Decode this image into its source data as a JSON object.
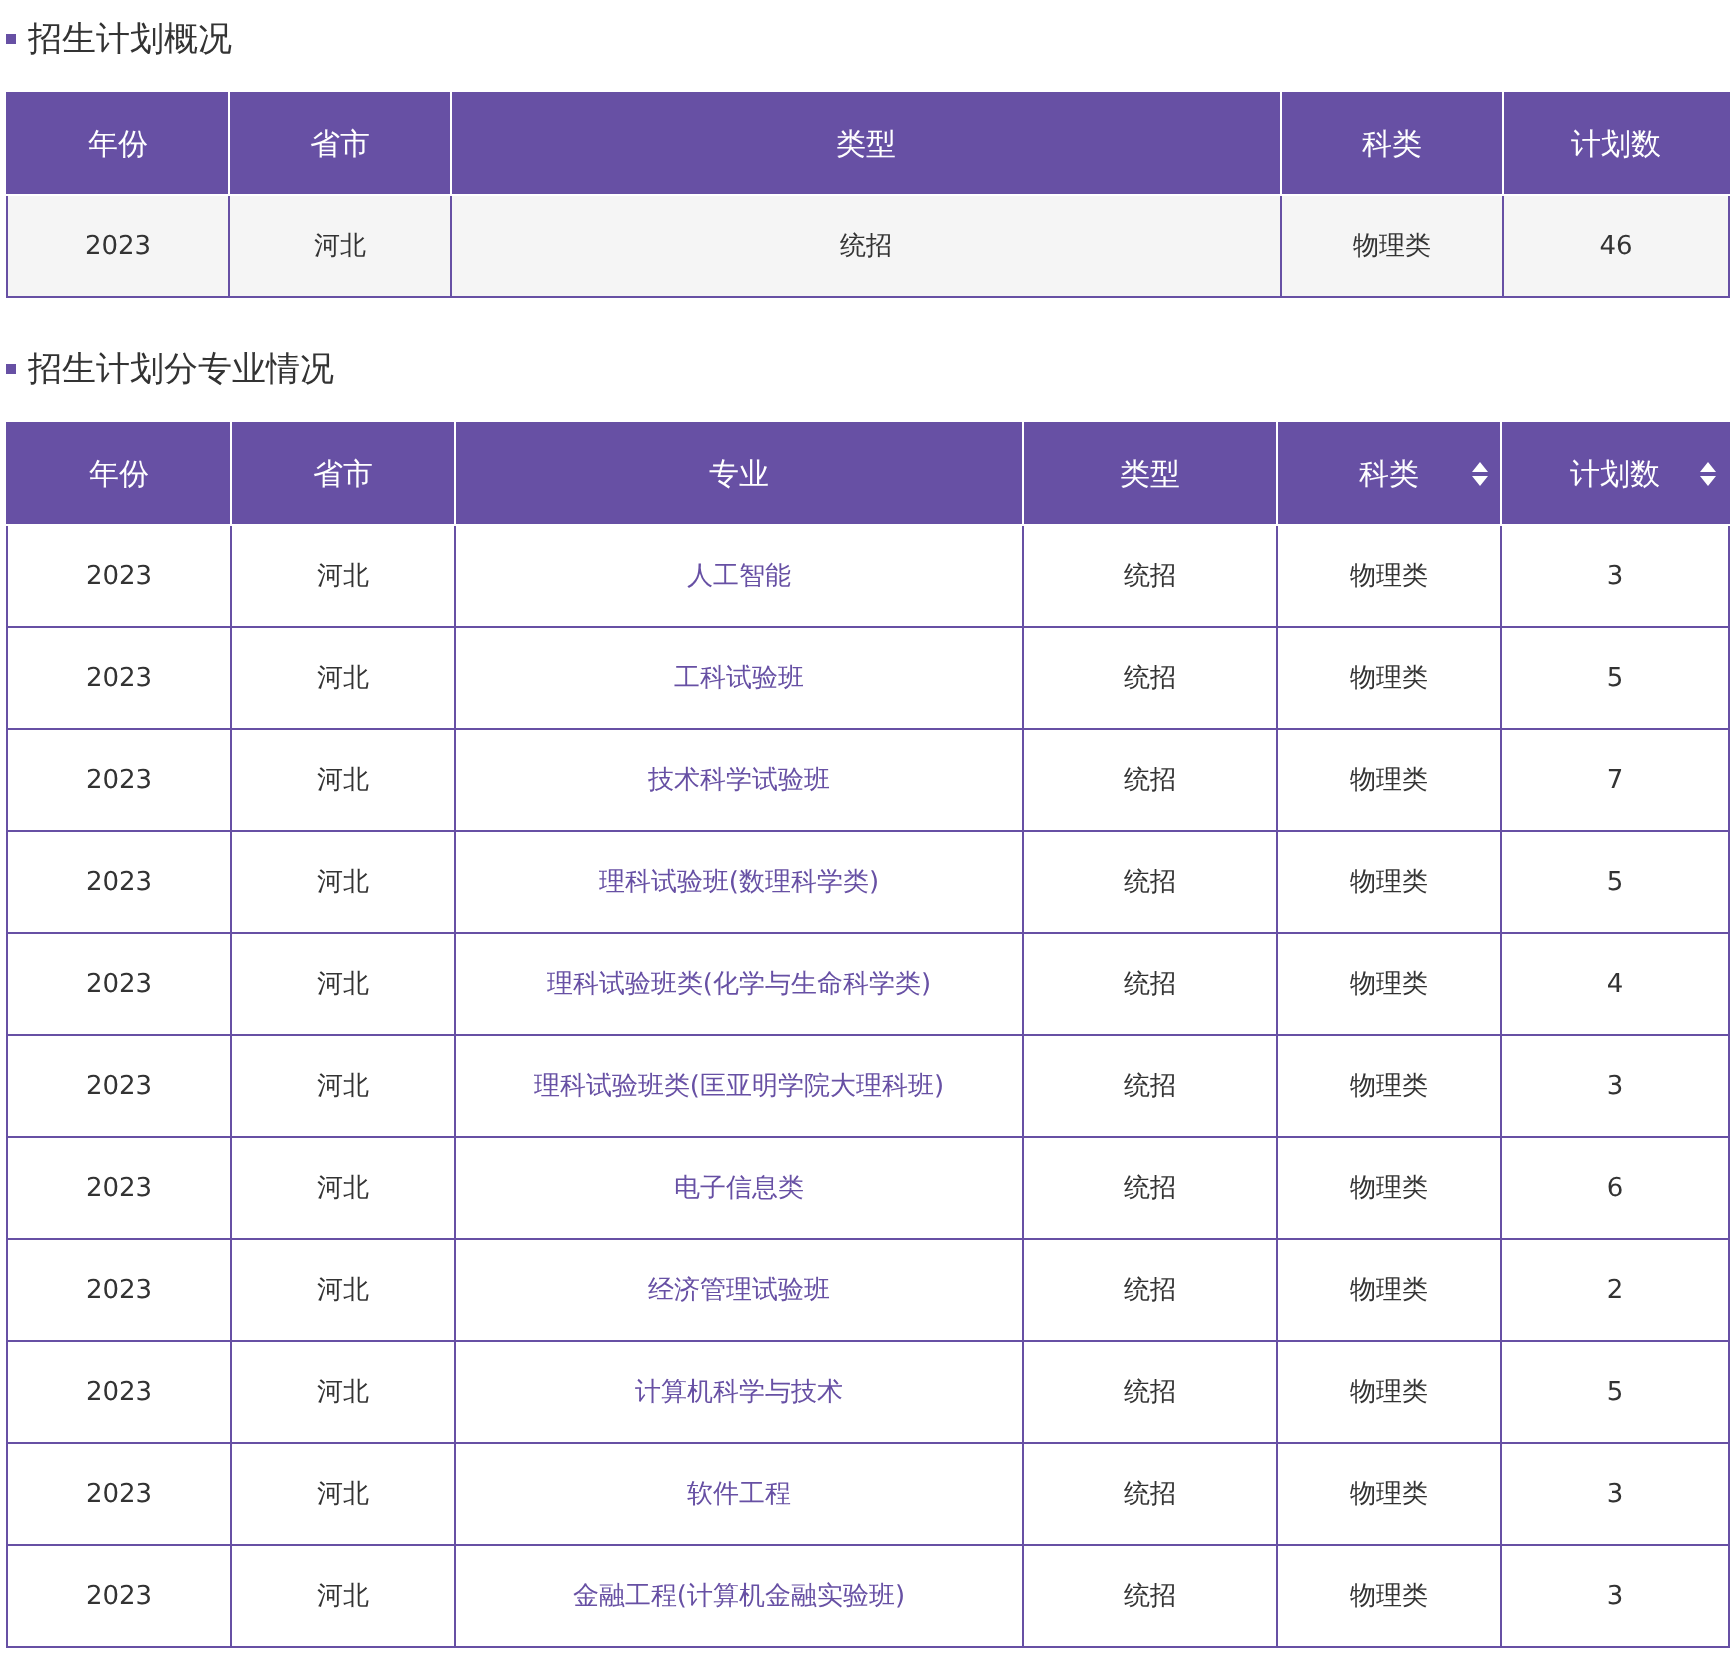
{
  "summary": {
    "title": "招生计划概况",
    "columns": [
      {
        "label": "年份",
        "sortable": false
      },
      {
        "label": "省市",
        "sortable": false
      },
      {
        "label": "类型",
        "sortable": false
      },
      {
        "label": "科类",
        "sortable": false
      },
      {
        "label": "计划数",
        "sortable": false
      }
    ],
    "rows": [
      [
        "2023",
        "河北",
        "统招",
        "物理类",
        "46"
      ]
    ]
  },
  "majors": {
    "title": "招生计划分专业情况",
    "columns": [
      {
        "label": "年份",
        "sortable": false
      },
      {
        "label": "省市",
        "sortable": false
      },
      {
        "label": "专业",
        "sortable": false
      },
      {
        "label": "类型",
        "sortable": false
      },
      {
        "label": "科类",
        "sortable": true
      },
      {
        "label": "计划数",
        "sortable": true
      }
    ],
    "rows": [
      [
        "2023",
        "河北",
        "人工智能",
        "统招",
        "物理类",
        "3"
      ],
      [
        "2023",
        "河北",
        "工科试验班",
        "统招",
        "物理类",
        "5"
      ],
      [
        "2023",
        "河北",
        "技术科学试验班",
        "统招",
        "物理类",
        "7"
      ],
      [
        "2023",
        "河北",
        "理科试验班(数理科学类)",
        "统招",
        "物理类",
        "5"
      ],
      [
        "2023",
        "河北",
        "理科试验班类(化学与生命科学类)",
        "统招",
        "物理类",
        "4"
      ],
      [
        "2023",
        "河北",
        "理科试验班类(匡亚明学院大理科班)",
        "统招",
        "物理类",
        "3"
      ],
      [
        "2023",
        "河北",
        "电子信息类",
        "统招",
        "物理类",
        "6"
      ],
      [
        "2023",
        "河北",
        "经济管理试验班",
        "统招",
        "物理类",
        "2"
      ],
      [
        "2023",
        "河北",
        "计算机科学与技术",
        "统招",
        "物理类",
        "5"
      ],
      [
        "2023",
        "河北",
        "软件工程",
        "统招",
        "物理类",
        "3"
      ],
      [
        "2023",
        "河北",
        "金融工程(计算机金融实验班)",
        "统招",
        "物理类",
        "3"
      ]
    ]
  }
}
